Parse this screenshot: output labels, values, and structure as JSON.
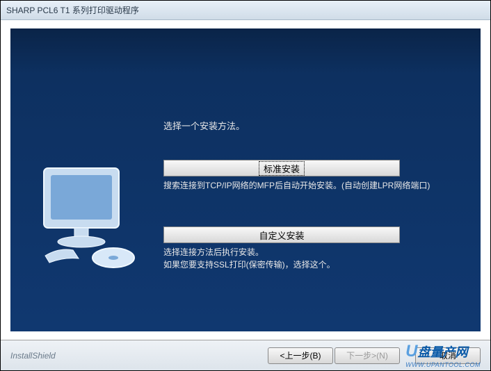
{
  "window": {
    "title": "SHARP  PCL6 T1 系列打印驱动程序"
  },
  "main": {
    "instruction": "选择一个安装方法。",
    "standard": {
      "label": "标准安装",
      "description": "搜索连接到TCP/IP网络的MFP后自动开始安装。(自动创建LPR网络端口)"
    },
    "custom": {
      "label": "自定义安装",
      "description_line1": "选择连接方法后执行安装。",
      "description_line2": "如果您要支持SSL打印(保密传输)，选择这个。"
    }
  },
  "footer": {
    "brand": "InstallShield",
    "back": "<上一步(B)",
    "next": "下一步>(N)",
    "cancel": "取消"
  },
  "watermark": {
    "text": "盘量产网",
    "url": "WWW.UPANTOOL.COM"
  }
}
